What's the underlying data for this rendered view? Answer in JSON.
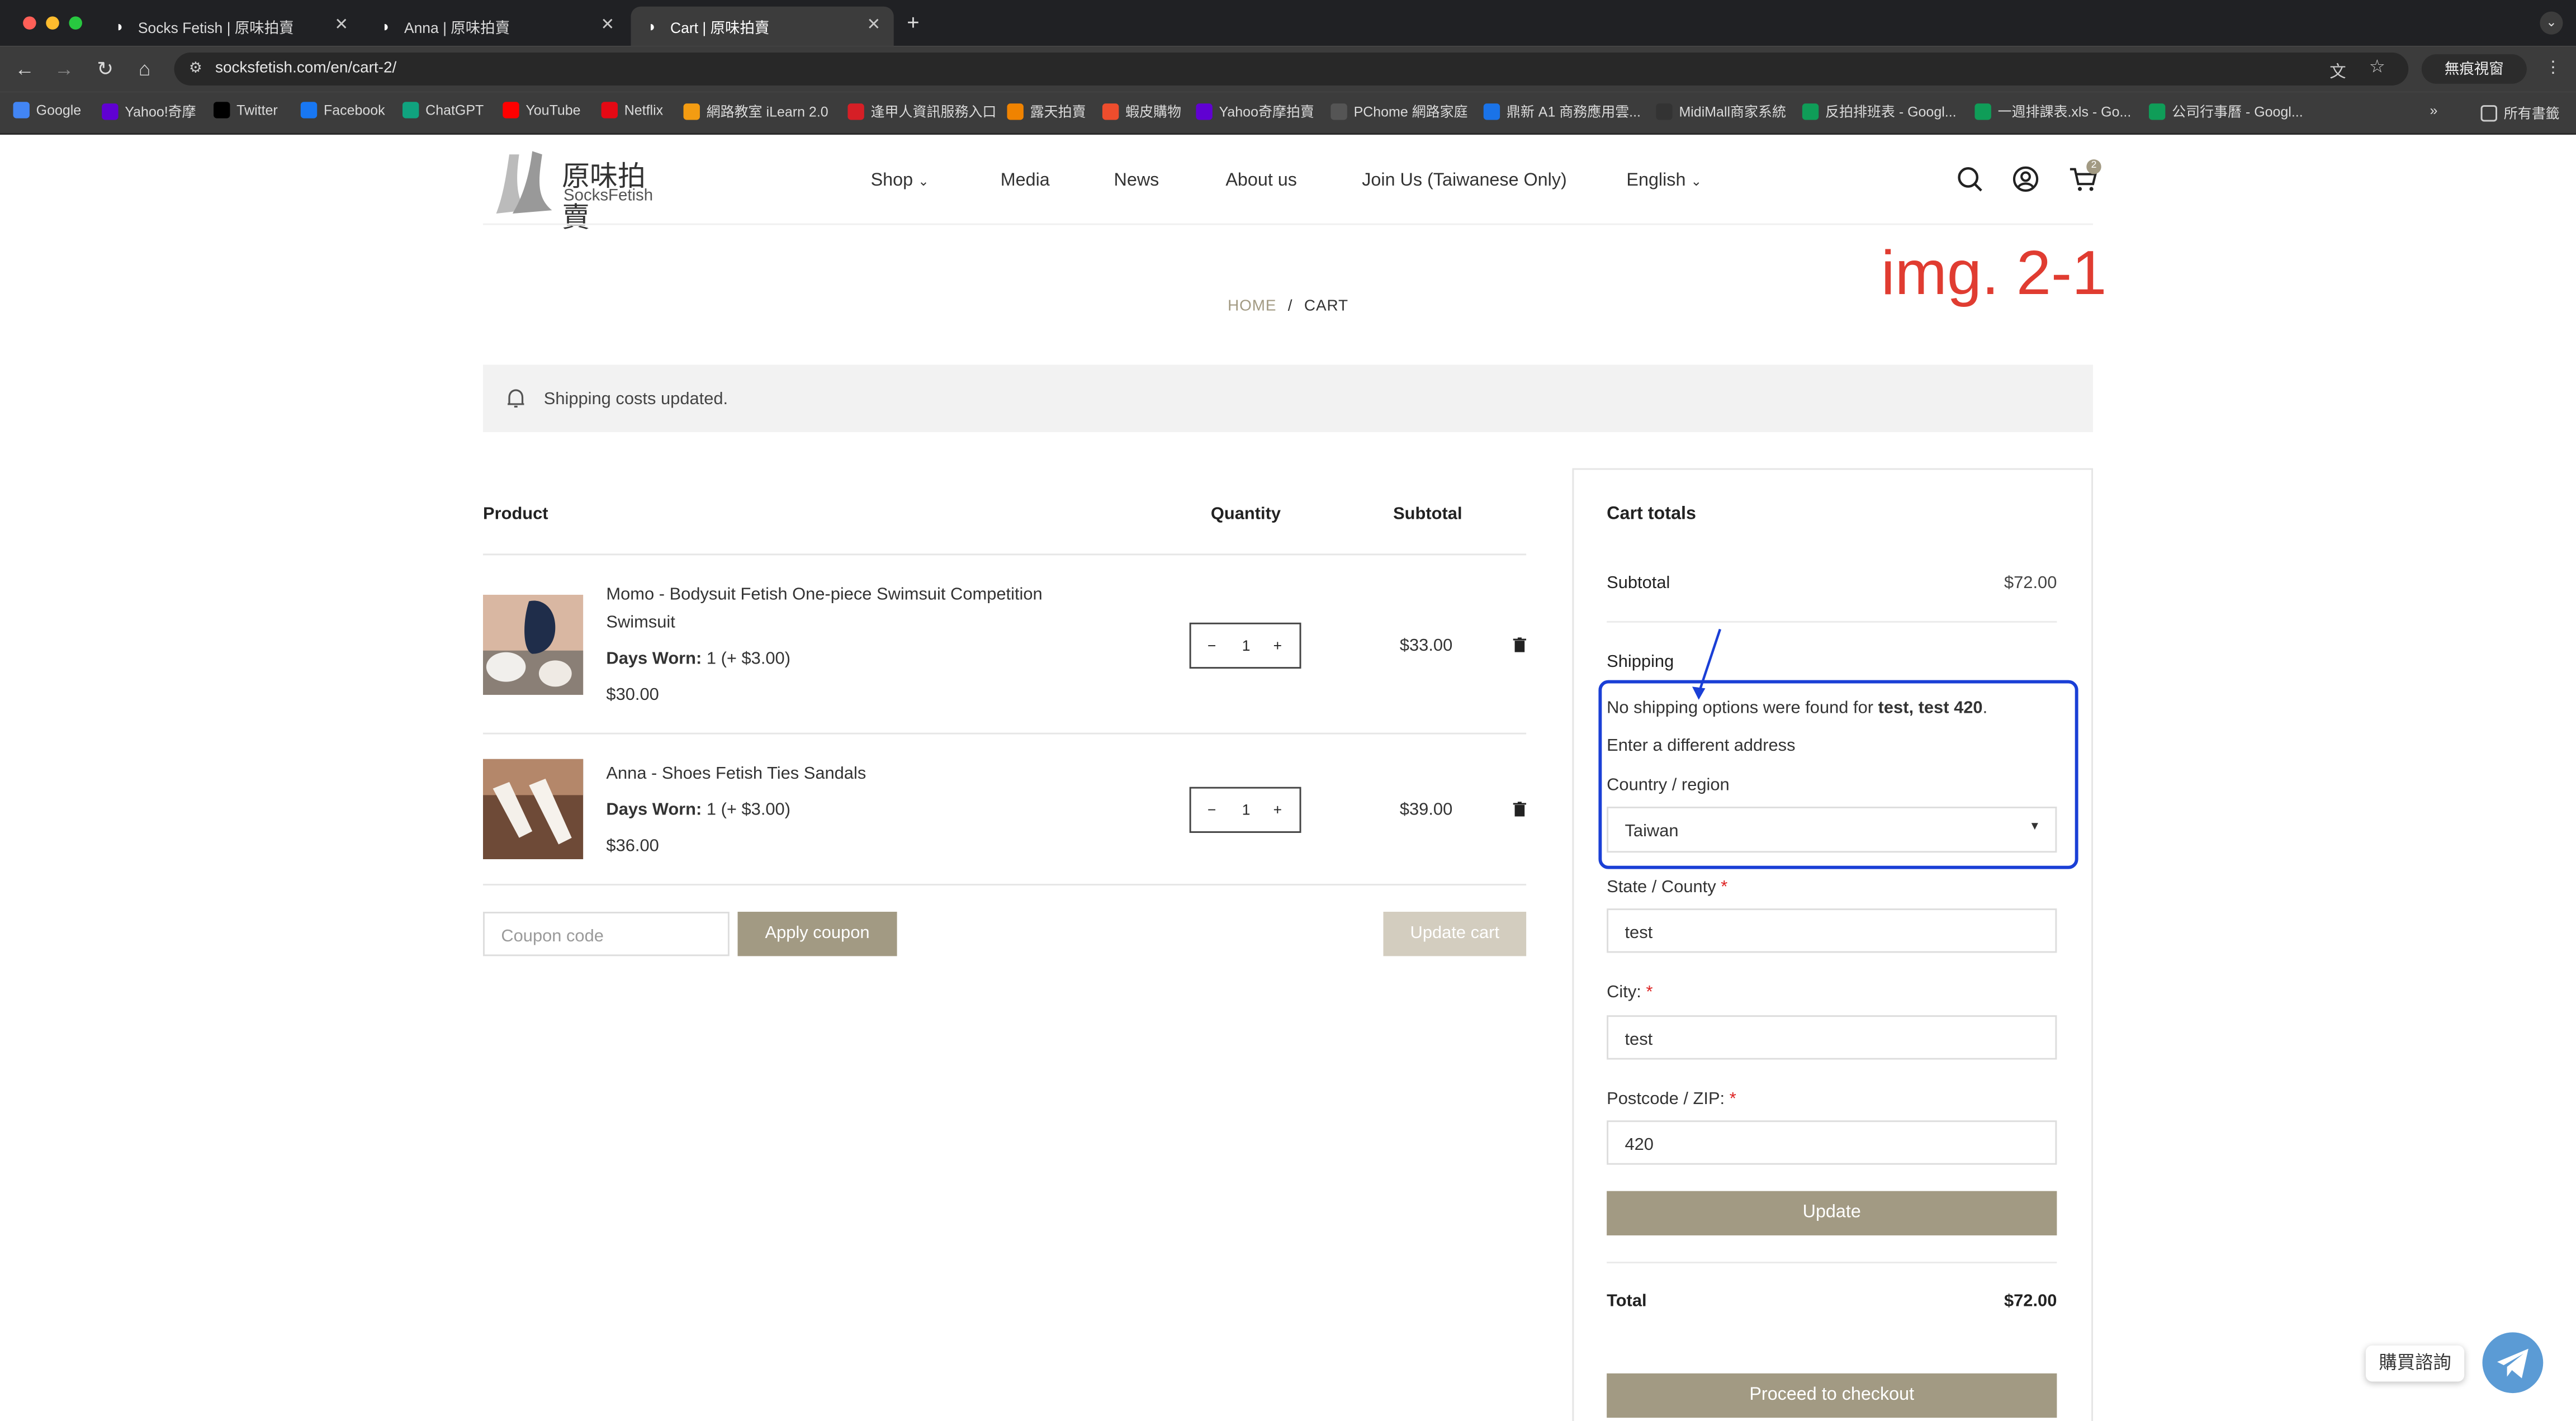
{
  "browser": {
    "tabs": [
      {
        "title": "Socks Fetish | 原味拍賣"
      },
      {
        "title": "Anna | 原味拍賣"
      },
      {
        "title": "Cart | 原味拍賣"
      }
    ],
    "new_tab": "+",
    "url": "socksfetish.com/en/cart-2/",
    "incognito_label": "無痕視窗",
    "bookmarks": [
      "Google",
      "Yahoo!奇摩",
      "Twitter",
      "Facebook",
      "ChatGPT",
      "YouTube",
      "Netflix",
      "網路教室 iLearn 2.0",
      "逢甲人資訊服務入口",
      "露天拍賣",
      "蝦皮購物",
      "Yahoo奇摩拍賣",
      "PChome 網路家庭",
      "鼎新 A1 商務應用雲...",
      "MidiMall商家系統",
      "反拍排班表 - Googl...",
      "一週排課表.xls - Go...",
      "公司行事曆 - Googl..."
    ],
    "all_bookmarks": "所有書籤",
    "more": "»"
  },
  "site": {
    "logo_cn": "原味拍賣",
    "logo_en": "SocksFetish",
    "nav": [
      "Shop",
      "Media",
      "News",
      "About us",
      "Join Us (Taiwanese Only)",
      "English"
    ],
    "cart_count": "2"
  },
  "annotation": {
    "tag": "img. 2-1"
  },
  "breadcrumb": {
    "home": "HOME",
    "sep": "/",
    "current": "CART"
  },
  "notice": "Shipping costs updated.",
  "cart": {
    "headers": {
      "product": "Product",
      "quantity": "Quantity",
      "subtotal": "Subtotal"
    },
    "items": [
      {
        "name": "Momo - Bodysuit Fetish One-piece Swimsuit Competition Swimsuit",
        "meta_label": "Days Worn:",
        "meta_value": " 1 (+ $3.00)",
        "price": "$30.00",
        "qty": "1",
        "subtotal": "$33.00"
      },
      {
        "name": "Anna - Shoes Fetish Ties Sandals",
        "meta_label": "Days Worn:",
        "meta_value": " 1 (+ $3.00)",
        "price": "$36.00",
        "qty": "1",
        "subtotal": "$39.00"
      }
    ],
    "minus": "−",
    "plus": "+",
    "coupon_placeholder": "Coupon code",
    "apply_coupon": "Apply coupon",
    "update_cart": "Update cart"
  },
  "totals": {
    "title": "Cart totals",
    "subtotal_label": "Subtotal",
    "subtotal_value": "$72.00",
    "shipping_label": "Shipping",
    "no_options_prefix": "No shipping options were found for ",
    "no_options_addr": "test, test 420",
    "no_options_suffix": ".",
    "different_address": "Enter a different address",
    "country_label": "Country / region",
    "country_value": "Taiwan",
    "state_label": "State / County",
    "state_value": "test",
    "city_label": "City:",
    "city_value": "test",
    "postcode_label": "Postcode / ZIP:",
    "postcode_value": "420",
    "req": "*",
    "update": "Update",
    "total_label": "Total",
    "total_value": "$72.00",
    "checkout": "Proceed to checkout"
  },
  "chat": {
    "label": "購買諮詢"
  },
  "colors": {
    "accent": "#a29a83",
    "disabled": "#d3cdbf",
    "annotation_red": "#e03c31",
    "annotation_blue": "#1a3fd6"
  }
}
